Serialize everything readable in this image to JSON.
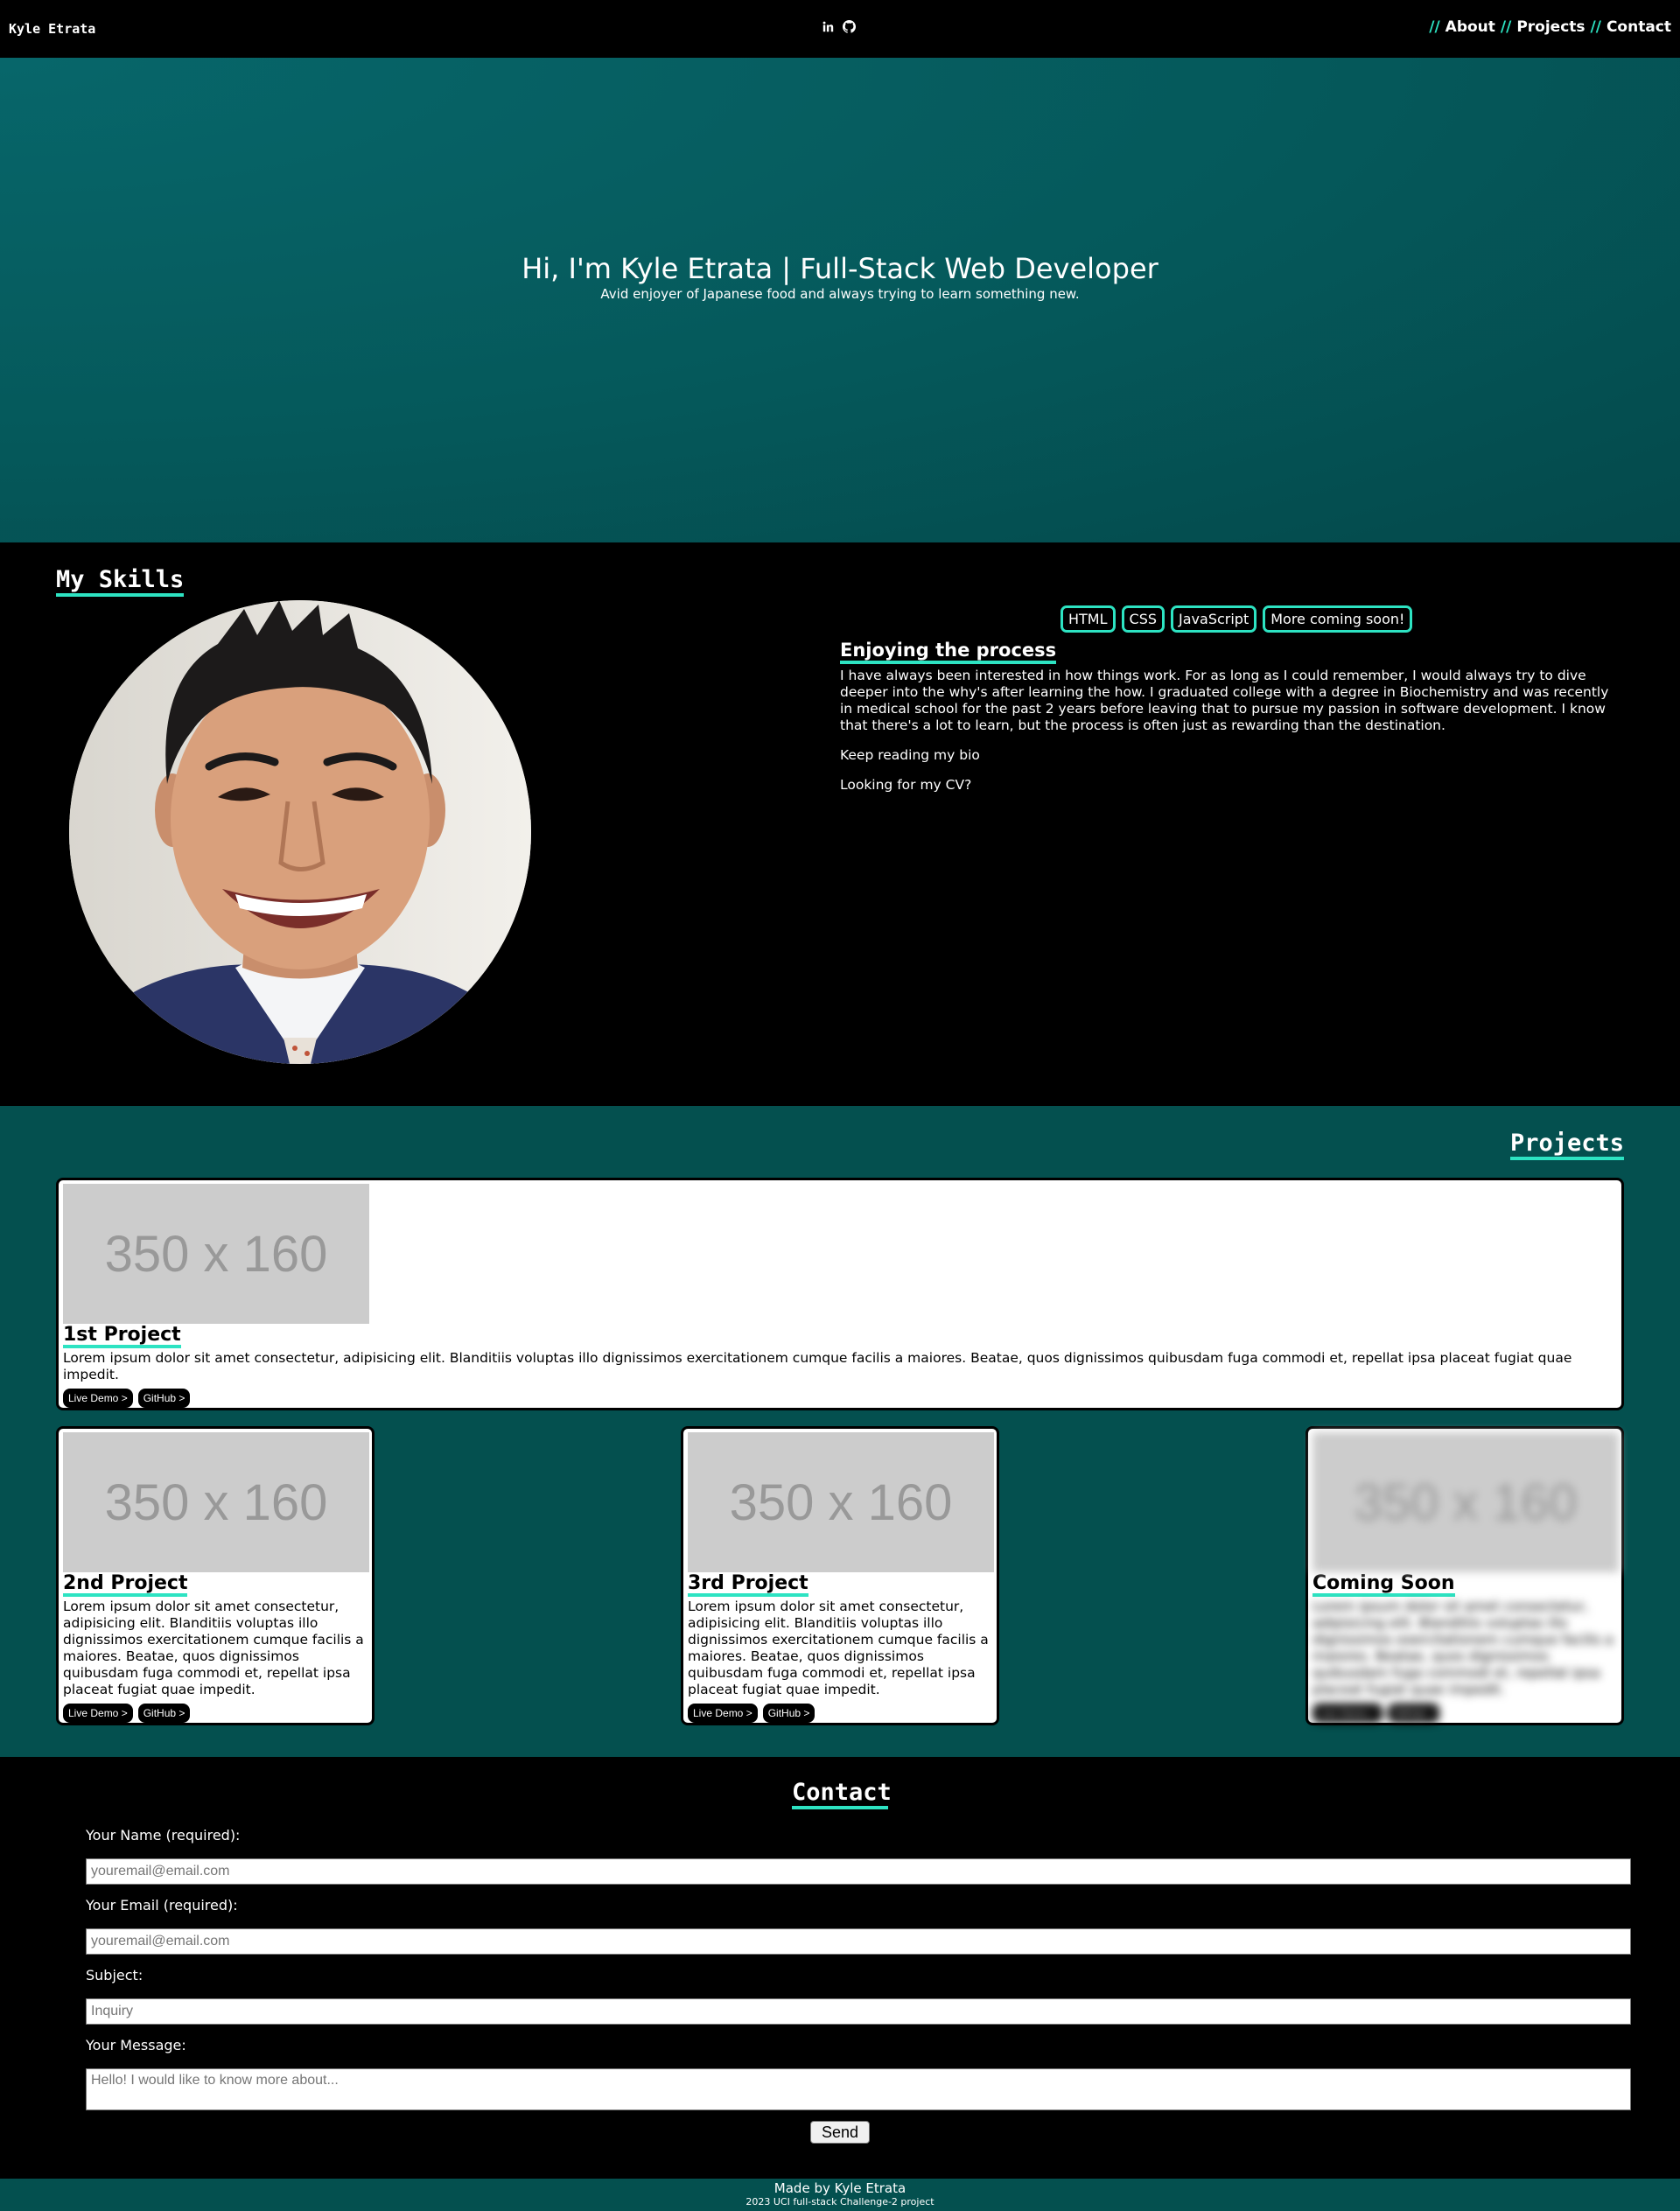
{
  "header": {
    "brand": "Kyle Etrata",
    "social_icons": [
      "linkedin-icon",
      "github-icon"
    ],
    "nav": [
      {
        "sep": "//",
        "label": "About"
      },
      {
        "sep": "//",
        "label": "Projects"
      },
      {
        "sep": "//",
        "label": "Contact"
      }
    ]
  },
  "hero": {
    "title": "Hi, I'm Kyle Etrata | Full-Stack Web Developer",
    "subtitle": "Avid enjoyer of Japanese food and always trying to learn something new."
  },
  "skills": {
    "title": "My Skills",
    "tags": [
      "HTML",
      "CSS",
      "JavaScript",
      "More coming soon!"
    ],
    "about_heading": "Enjoying the process",
    "about_text": "I have always been interested in how things work. For as long as I could remember, I would always try to dive deeper into the why's after learning the how. I graduated college with a degree in Biochemistry and was recently in medical school for the past 2 years before leaving that to pursue my passion in software development. I know that there's a lot to learn, but the process is often just as rewarding than the destination.",
    "bio_link": "Keep reading my bio",
    "cv_link": "Looking for my CV?"
  },
  "projects": {
    "title": "Projects",
    "items": [
      {
        "thumb": "350 x 160",
        "title": "1st Project",
        "desc": "Lorem ipsum dolor sit amet consectetur, adipisicing elit. Blanditiis voluptas illo dignissimos exercitationem cumque facilis a maiores. Beatae, quos dignissimos quibusdam fuga commodi et, repellat ipsa placeat fugiat quae impedit.",
        "demo": "Live Demo >",
        "github": "GitHub >"
      },
      {
        "thumb": "350 x 160",
        "title": "2nd Project",
        "desc": "Lorem ipsum dolor sit amet consectetur, adipisicing elit. Blanditiis voluptas illo dignissimos exercitationem cumque facilis a maiores. Beatae, quos dignissimos quibusdam fuga commodi et, repellat ipsa placeat fugiat quae impedit.",
        "demo": "Live Demo >",
        "github": "GitHub >"
      },
      {
        "thumb": "350 x 160",
        "title": "3rd Project",
        "desc": "Lorem ipsum dolor sit amet consectetur, adipisicing elit. Blanditiis voluptas illo dignissimos exercitationem cumque facilis a maiores. Beatae, quos dignissimos quibusdam fuga commodi et, repellat ipsa placeat fugiat quae impedit.",
        "demo": "Live Demo >",
        "github": "GitHub >"
      },
      {
        "thumb": "350 x 160",
        "title": "Coming Soon",
        "desc": "Lorem ipsum dolor sit amet consectetur, adipisicing elit. Blanditiis voluptas illo dignissimos exercitationem cumque facilis a maiores. Beatae, quos dignissimos quibusdam fuga commodi et, repellat ipsa placeat fugiat quae impedit.",
        "demo": "Live Demo >",
        "github": "GitHub >"
      }
    ]
  },
  "contact": {
    "title": "Contact",
    "name_label": "Your Name (required):",
    "name_placeholder": "youremail@email.com",
    "email_label": "Your Email (required):",
    "email_placeholder": "youremail@email.com",
    "subject_label": "Subject:",
    "subject_placeholder": "Inquiry",
    "message_label": "Your Message:",
    "message_placeholder": "Hello! I would like to know more about...",
    "send_label": "Send"
  },
  "footer": {
    "line1": "Made by Kyle Etrata",
    "line2": "2023 UCI full-stack Challenge-2 project"
  },
  "colors": {
    "accent": "#2de3c2",
    "teal": "#04504f",
    "background": "#000000"
  }
}
